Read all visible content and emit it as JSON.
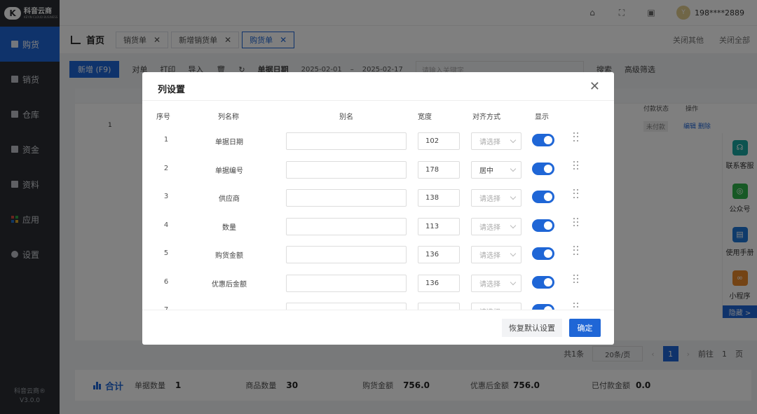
{
  "app": {
    "logo_mark": "K",
    "logo_name": "科音云商",
    "logo_sub": "KEYIN CLOUD BUSINESS",
    "version_name": "科音云商®",
    "version": "V3.0.0"
  },
  "sidebar": {
    "items": [
      {
        "label": "购货",
        "icon": "cart-icon",
        "active": true
      },
      {
        "label": "销货",
        "icon": "sales-icon"
      },
      {
        "label": "仓库",
        "icon": "warehouse-icon"
      },
      {
        "label": "资金",
        "icon": "funds-icon"
      },
      {
        "label": "资料",
        "icon": "data-icon"
      },
      {
        "label": "应用",
        "icon": "apps-icon"
      },
      {
        "label": "设置",
        "icon": "gear-icon"
      }
    ]
  },
  "topbar": {
    "icons": [
      "home-icon",
      "fullscreen-icon",
      "lock-icon"
    ],
    "avatar_initial": "Y",
    "username": "198****2889"
  },
  "tabs": {
    "home_label": "首页",
    "items": [
      {
        "label": "销货单"
      },
      {
        "label": "新增销货单"
      },
      {
        "label": "购货单",
        "active": true
      }
    ],
    "close_others": "关闭其他",
    "close_all": "关闭全部"
  },
  "toolbar": {
    "add_label": "新增 (F9)",
    "audit_label": "对单",
    "print_label": "打印",
    "import_label": "导入",
    "date_label": "单据日期",
    "date_from": "2025-02-01",
    "date_sep": "–",
    "date_to": "2025-02-17",
    "keyword_placeholder": "请输入关键字",
    "search_label": "搜索",
    "advanced_filter": "高级筛选"
  },
  "grid": {
    "first_row_index": "1",
    "col_pay_status": "付款状态",
    "col_actions": "操作",
    "row_pay_status": "未付款",
    "row_edit": "编辑",
    "row_delete": "删除"
  },
  "pager": {
    "total": "共1条",
    "page_size": "20条/页",
    "current": "1",
    "goto_label": "前往",
    "goto_value": "1",
    "page_suffix": "页"
  },
  "summary": {
    "title": "合计",
    "items": [
      {
        "label": "单据数量",
        "value": "1"
      },
      {
        "label": "商品数量",
        "value": "30"
      },
      {
        "label": "购货金额",
        "value": "756.0"
      },
      {
        "label": "优惠后金额",
        "value": "756.0"
      },
      {
        "label": "已付款金额",
        "value": "0.0"
      }
    ]
  },
  "service_panel": {
    "items": [
      {
        "label": "联系客服",
        "icon": "headset-icon",
        "color": "#19a6a0"
      },
      {
        "label": "公众号",
        "icon": "wechat-icon",
        "color": "#2fb34a"
      },
      {
        "label": "使用手册",
        "icon": "manual-icon",
        "color": "#1f77d6"
      },
      {
        "label": "小程序",
        "icon": "miniapp-icon",
        "color": "#e9892b"
      }
    ],
    "hide_label": "隐藏 >"
  },
  "modal": {
    "title": "列设置",
    "headers": {
      "seq": "序号",
      "name": "列名称",
      "alias": "别名",
      "width": "宽度",
      "align": "对齐方式",
      "show": "显示"
    },
    "select_placeholder": "请选择",
    "rows": [
      {
        "seq": "1",
        "name": "单据日期",
        "alias": "",
        "width": "102",
        "align": "",
        "show": true
      },
      {
        "seq": "2",
        "name": "单据编号",
        "alias": "",
        "width": "178",
        "align": "居中",
        "show": true
      },
      {
        "seq": "3",
        "name": "供应商",
        "alias": "",
        "width": "138",
        "align": "",
        "show": true
      },
      {
        "seq": "4",
        "name": "数量",
        "alias": "",
        "width": "113",
        "align": "",
        "show": true
      },
      {
        "seq": "5",
        "name": "购货金额",
        "alias": "",
        "width": "136",
        "align": "",
        "show": true
      },
      {
        "seq": "6",
        "name": "优惠后金额",
        "alias": "",
        "width": "136",
        "align": "",
        "show": true
      },
      {
        "seq": "7",
        "name": "",
        "alias": "",
        "width": "",
        "align": "",
        "show": true
      }
    ],
    "reset_label": "恢复默认设置",
    "confirm_label": "确定"
  },
  "colors": {
    "primary": "#1f66d6",
    "sidebar_bg": "#2b2d33"
  }
}
